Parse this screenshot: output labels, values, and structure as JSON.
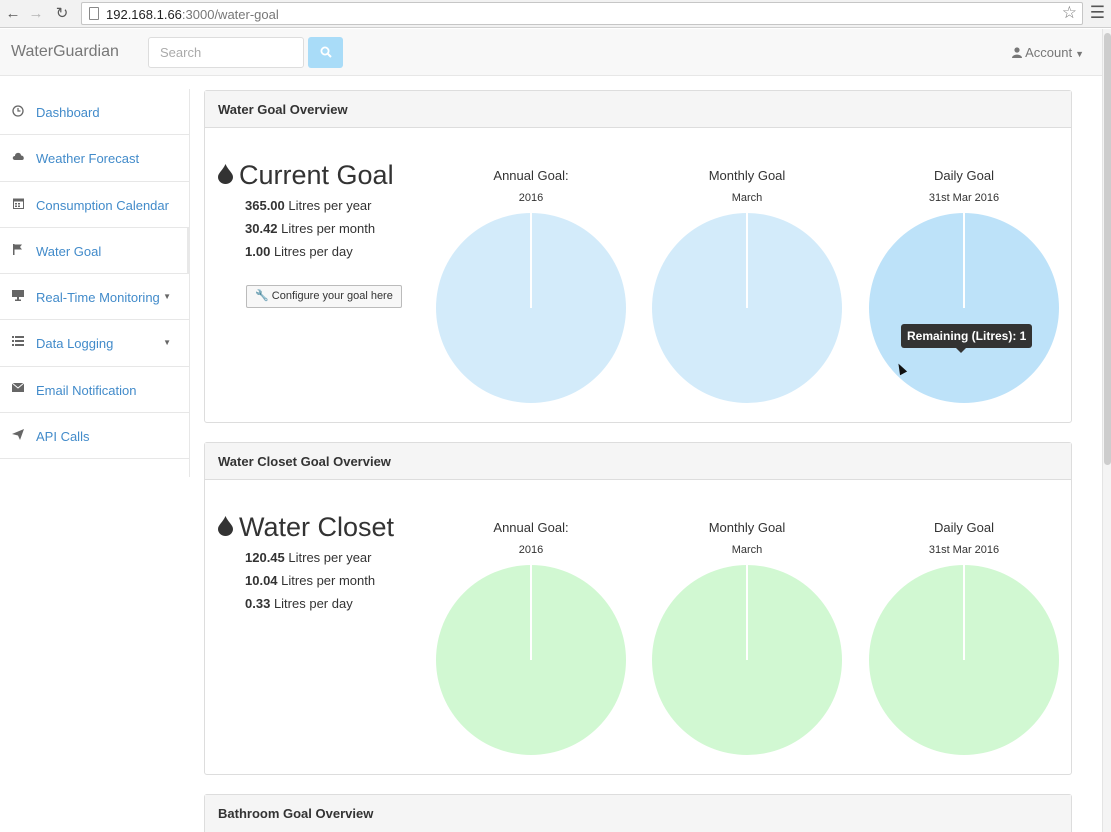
{
  "browser": {
    "url_host": "192.168.1.66",
    "url_path": ":3000/water-goal"
  },
  "navbar": {
    "brand": "WaterGuardian",
    "search_placeholder": "Search",
    "account_label": "Account"
  },
  "sidebar": {
    "items": [
      {
        "label": "Dashboard",
        "icon": "clock-icon"
      },
      {
        "label": "Weather Forecast",
        "icon": "cloud-icon"
      },
      {
        "label": "Consumption Calendar",
        "icon": "calendar-icon"
      },
      {
        "label": "Water Goal",
        "icon": "flag-icon"
      },
      {
        "label": "Real-Time Monitoring",
        "icon": "monitor-icon"
      },
      {
        "label": "Data Logging",
        "icon": "list-icon"
      },
      {
        "label": "Email Notification",
        "icon": "envelope-icon"
      },
      {
        "label": "API Calls",
        "icon": "send-icon"
      }
    ]
  },
  "panels": [
    {
      "heading": "Water Goal Overview",
      "title": "Current Goal",
      "stats": [
        {
          "value": "365.00",
          "unit": "Litres per year"
        },
        {
          "value": "30.42",
          "unit": "Litres per month"
        },
        {
          "value": "1.00",
          "unit": "Litres per day"
        }
      ],
      "config_label": "Configure your goal here",
      "pies": [
        {
          "label": "Annual Goal:",
          "sub": "2016"
        },
        {
          "label": "Monthly Goal",
          "sub": "March"
        },
        {
          "label": "Daily Goal",
          "sub": "31st Mar 2016"
        }
      ],
      "color": "#d3ebfa",
      "hover_color": "#bde2f9"
    },
    {
      "heading": "Water Closet Goal Overview",
      "title": "Water Closet",
      "stats": [
        {
          "value": "120.45",
          "unit": "Litres per year"
        },
        {
          "value": "10.04",
          "unit": "Litres per month"
        },
        {
          "value": "0.33",
          "unit": "Litres per day"
        }
      ],
      "pies": [
        {
          "label": "Annual Goal:",
          "sub": "2016"
        },
        {
          "label": "Monthly Goal",
          "sub": "March"
        },
        {
          "label": "Daily Goal",
          "sub": "31st Mar 2016"
        }
      ],
      "color": "#d1f8d2"
    },
    {
      "heading": "Bathroom Goal Overview"
    }
  ],
  "tooltip": "Remaining (Litres): 1"
}
